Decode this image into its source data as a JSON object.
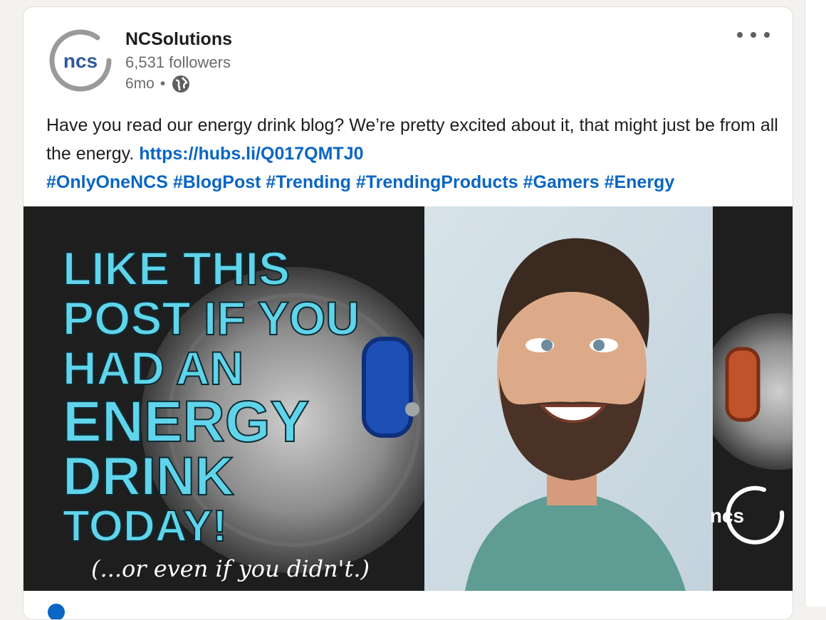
{
  "post": {
    "author_name": "NCSolutions",
    "followers": "6,531 followers",
    "time_ago": "6mo",
    "separator": "•",
    "text_intro": "Have you read our energy drink blog? We’re pretty excited about it, that might just be from all the energy. ",
    "link": "https://hubs.li/Q017QMTJ0",
    "hashtags": [
      "#OnlyOneNCS",
      "#BlogPost",
      "#Trending",
      "#TrendingProducts",
      "#Gamers",
      "#Energy"
    ],
    "logo_text": "ncs"
  },
  "image": {
    "headline_lines": [
      "LIKE THIS",
      "POST IF YOU",
      "HAD AN",
      "ENERGY",
      "DRINK",
      "TODAY!"
    ],
    "subline": "(...or even if you didn't.)",
    "badge_text": "ncs"
  },
  "colors": {
    "accent_link": "#0a66c2",
    "headline": "#5fd4ea",
    "logo_blue": "#2e5a9e",
    "logo_ring": "#9a9a9a"
  },
  "icons": {
    "globe": "globe-icon",
    "more": "more-options-icon"
  }
}
